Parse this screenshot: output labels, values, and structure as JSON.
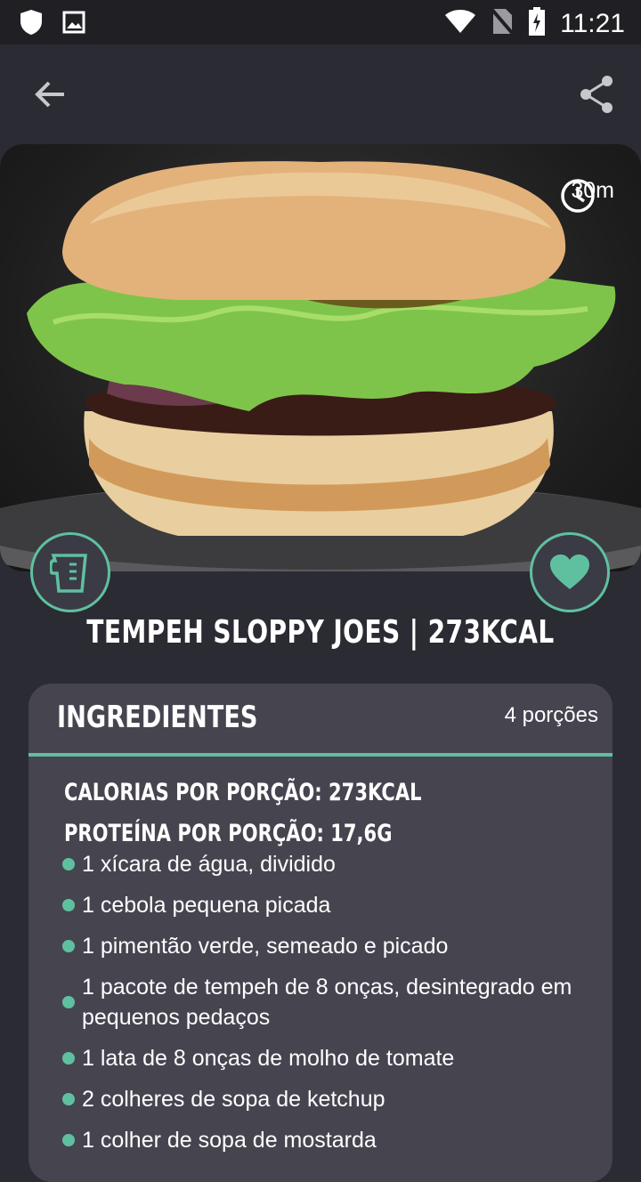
{
  "status_bar": {
    "time": "11:21"
  },
  "hero": {
    "time_label": "30m"
  },
  "recipe": {
    "title": "TEMPEH SLOPPY JOES | 273KCAL"
  },
  "ingredients_card": {
    "title": "INGREDIENTES",
    "servings": "4 porções",
    "calories": "CALORIAS POR PORÇÃO: 273KCAL",
    "protein": "PROTEÍNA POR PORÇÃO: 17,6G",
    "items": [
      "1 xícara de água, dividido",
      "1 cebola pequena picada",
      "1 pimentão verde, semeado e picado",
      "1 pacote de tempeh de 8 onças, desintegrado em pequenos pedaços",
      "1 lata de 8 onças de molho de tomate",
      "2 colheres de sopa de ketchup",
      "1 colher de sopa de mostarda"
    ]
  },
  "colors": {
    "accent": "#5fc0a0",
    "background": "#2b2b33",
    "card": "#46444f"
  },
  "icons": [
    "shield-icon",
    "image-icon",
    "wifi-icon",
    "no-sim-icon",
    "battery-icon",
    "back-arrow-icon",
    "share-icon",
    "clock-icon",
    "measuring-cup-icon",
    "heart-icon"
  ]
}
